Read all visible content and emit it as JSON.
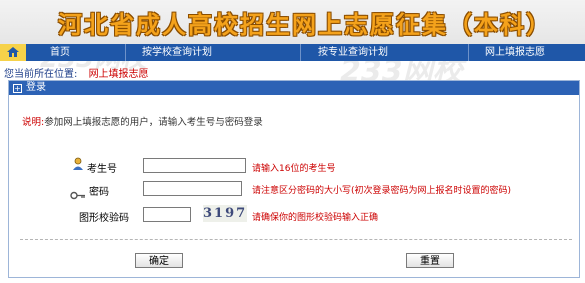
{
  "banner": {
    "title": "河北省成人高校招生网上志愿征集（本科）"
  },
  "watermark": {
    "text": "233网校",
    "url": "www.233.com"
  },
  "nav": {
    "home": "首页",
    "items": [
      "按学校查询计划",
      "按专业查询计划",
      "网上填报志愿"
    ]
  },
  "breadcrumb": {
    "prefix": "您当前所在位置:",
    "current": "网上填报志愿"
  },
  "panel": {
    "title": "登录",
    "note_label": "说明:",
    "note_text": "参加网上填报志愿的用户，请输入考生号与密码登录"
  },
  "form": {
    "exam_id": {
      "label": "考生号",
      "value": "",
      "hint": "请输入16位的考生号"
    },
    "password": {
      "label": "密码",
      "value": "",
      "hint": "请注意区分密码的大小写(初次登录密码为网上报名时设置的密码)"
    },
    "captcha": {
      "label": "图形校验码",
      "value": "",
      "image_text": "3197",
      "hint": "请确保你的图形校验码输入正确"
    }
  },
  "buttons": {
    "confirm": "确定",
    "reset": "重置"
  },
  "colors": {
    "nav_bg": "#1f57a8",
    "header_bg": "#2c62b5",
    "hint_red": "#cc0000",
    "banner_orange": "#f4a21b"
  }
}
